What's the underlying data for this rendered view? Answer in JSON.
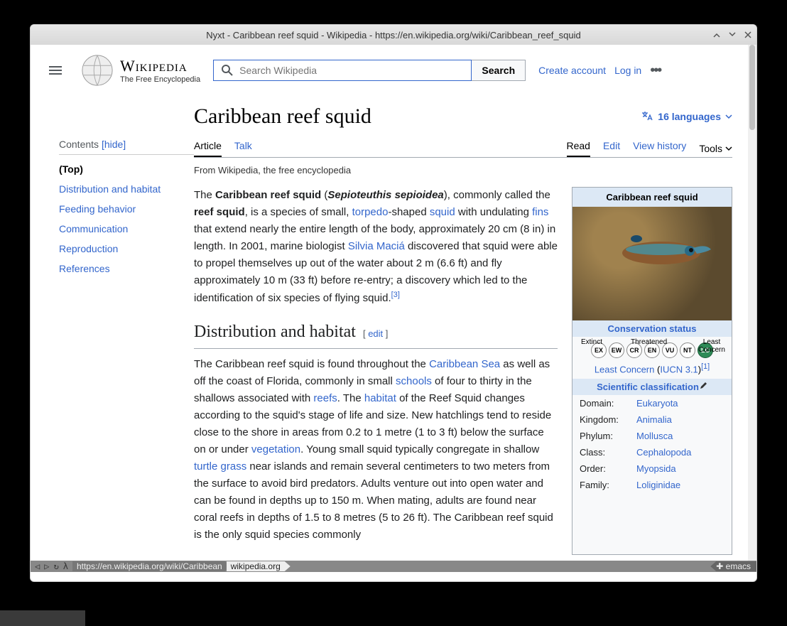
{
  "window_title": "Nyxt - Caribbean reef squid - Wikipedia - https://en.wikipedia.org/wiki/Caribbean_reef_squid",
  "logo": {
    "title": "Wikipedia",
    "subtitle": "The Free Encyclopedia"
  },
  "search": {
    "placeholder": "Search Wikipedia",
    "button": "Search"
  },
  "user": {
    "create": "Create account",
    "login": "Log in"
  },
  "sidebar": {
    "title": "Contents",
    "hide": "hide",
    "items": [
      "(Top)",
      "Distribution and habitat",
      "Feeding behavior",
      "Communication",
      "Reproduction",
      "References"
    ]
  },
  "article": {
    "title": "Caribbean reef squid",
    "languages": "16 languages",
    "tabs_left": [
      "Article",
      "Talk"
    ],
    "tabs_right": [
      "Read",
      "Edit",
      "View history"
    ],
    "tools": "Tools",
    "tagline": "From Wikipedia, the free encyclopedia",
    "intro": {
      "pre": "The ",
      "bold1": "Caribbean reef squid",
      "paren_open": " (",
      "sci": "Sepioteuthis sepioidea",
      "post1": "), commonly called the ",
      "bold2": "reef squid",
      "post2": ", is a species of small, ",
      "link_torpedo": "torpedo",
      "post3": "-shaped ",
      "link_squid": "squid",
      "post4": " with undulating ",
      "link_fins": "fins",
      "post5": " that extend nearly the entire length of the body, approximately 20 cm (8 in) in length. In 2001, marine biologist ",
      "link_macia": "Silvia Maciá",
      "post6": " discovered that squid were able to propel themselves up out of the water about 2 m (6.6 ft) and fly approximately 10 m (33 ft) before re-entry; a discovery which led to the identification of six species of flying squid.",
      "ref": "[3]"
    },
    "h2_dist": "Distribution and habitat",
    "edit": "edit",
    "dist": {
      "t1": "The Caribbean reef squid is found throughout the ",
      "link_cs": "Caribbean Sea",
      "t2": " as well as off the coast of Florida, commonly in small ",
      "link_schools": "schools",
      "t3": " of four to thirty in the shallows associated with ",
      "link_reefs": "reefs",
      "t4": ". The ",
      "link_habitat": "habitat",
      "t5": " of the Reef Squid changes according to the squid's stage of life and size. New hatchlings tend to reside close to the shore in areas from 0.2 to 1 metre (1 to 3 ft) below the surface on or under ",
      "link_veg": "vegetation",
      "t6": ". Young small squid typically congregate in shallow ",
      "link_tg": "turtle grass",
      "t7": " near islands and remain several centimeters to two meters from the surface to avoid bird predators. Adults venture out into open water and can be found in depths up to 150 m. When mating, adults are found near coral reefs in depths of 1.5 to 8 metres (5 to 26 ft). The Caribbean reef squid is the only squid species commonly"
    }
  },
  "infobox": {
    "title": "Caribbean reef squid",
    "cons_header": "Conservation status",
    "cons_labels": {
      "ex": "Extinct",
      "th": "Threatened",
      "lc": "Least Concern"
    },
    "cons_codes": [
      "EX",
      "EW",
      "CR",
      "EN",
      "VU",
      "NT",
      "LC"
    ],
    "status_text": "Least Concern",
    "iucn": "IUCN 3.1",
    "status_ref": "[1]",
    "class_header": "Scientific classification",
    "rows": [
      {
        "k": "Domain:",
        "v": "Eukaryota"
      },
      {
        "k": "Kingdom:",
        "v": "Animalia"
      },
      {
        "k": "Phylum:",
        "v": "Mollusca"
      },
      {
        "k": "Class:",
        "v": "Cephalopoda"
      },
      {
        "k": "Order:",
        "v": "Myopsida"
      },
      {
        "k": "Family:",
        "v": "Loliginidae"
      }
    ]
  },
  "statusbar": {
    "url": "https://en.wikipedia.org/wiki/Caribbean",
    "domain": "wikipedia.org",
    "mode": "emacs"
  }
}
